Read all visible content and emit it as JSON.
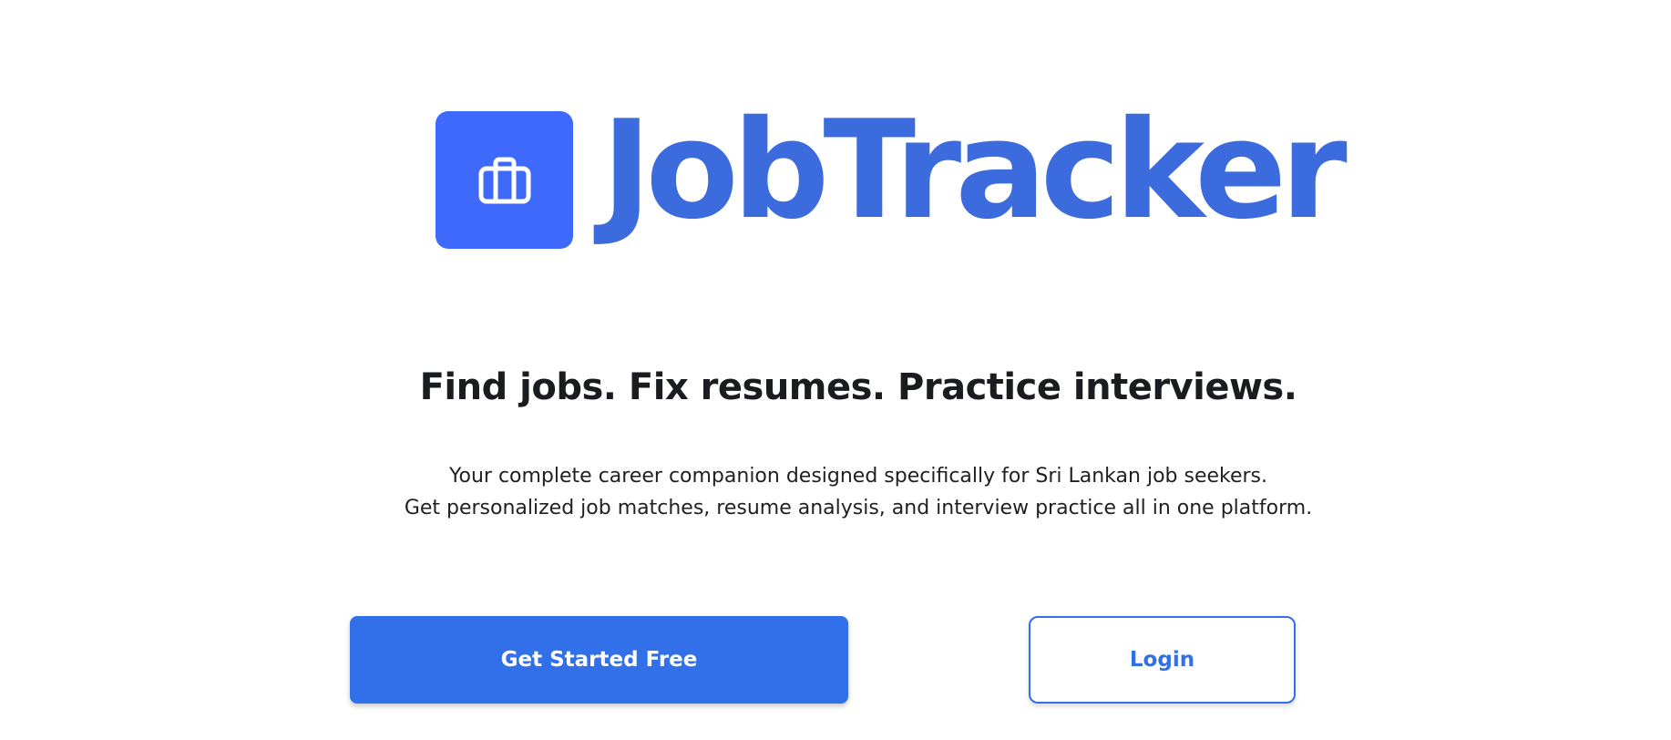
{
  "brand": {
    "name": "JobTracker",
    "logo_icon": "briefcase-icon",
    "logo_bg_color": "#3e69fb",
    "title_color": "#3b6bdc"
  },
  "hero": {
    "headline": "Find jobs. Fix resumes. Practice interviews.",
    "description_line1": "Your complete career companion designed specifically for Sri Lankan job seekers.",
    "description_line2": "Get personalized job matches, resume analysis, and interview practice all in one platform."
  },
  "actions": {
    "primary_label": "Get Started Free",
    "secondary_label": "Login",
    "accent_color": "#3170e8"
  }
}
